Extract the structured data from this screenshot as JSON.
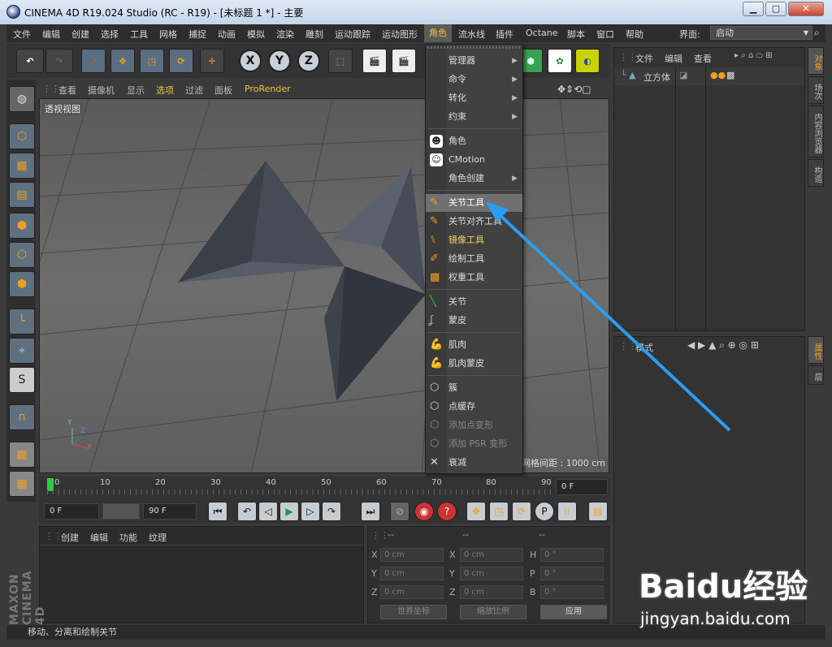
{
  "window": {
    "title": "CINEMA 4D R19.024 Studio (RC - R19) - [未标题 1 *] - 主要",
    "min": "▁",
    "max": "▢",
    "close": "✕"
  },
  "menubar": {
    "items": [
      "文件",
      "编辑",
      "创建",
      "选择",
      "工具",
      "网格",
      "捕捉",
      "动画",
      "模拟",
      "渲染",
      "雕刻",
      "运动跟踪",
      "运动图形",
      "角色",
      "流水线",
      "插件",
      "Octane",
      "脚本",
      "窗口",
      "帮助"
    ],
    "iface_label": "界面:",
    "iface_value": "启动"
  },
  "toolbar": {
    "x": "X",
    "y": "Y",
    "z": "Z"
  },
  "viewport": {
    "menu": [
      "查看",
      "摄像机",
      "显示",
      "选项",
      "过滤",
      "面板",
      "ProRender"
    ],
    "label": "透视视图",
    "grid_spacing": "网格间距 : 1000 cm",
    "axes": {
      "x": "X",
      "y": "Y",
      "z": "Z"
    }
  },
  "timeline": {
    "ticks": [
      "0",
      "10",
      "20",
      "30",
      "40",
      "50",
      "60",
      "70",
      "80",
      "90"
    ],
    "frame_field": "0 F"
  },
  "playback": {
    "start": "0 F",
    "end": "90 F"
  },
  "material_panel": {
    "menu": [
      "创建",
      "编辑",
      "功能",
      "纹理"
    ]
  },
  "coord_panel": {
    "headers": [
      "--",
      "--",
      "--"
    ],
    "rows": [
      {
        "a": "X",
        "av": "0 cm",
        "b": "X",
        "bv": "0 cm",
        "c": "H",
        "cv": "0 °"
      },
      {
        "a": "Y",
        "av": "0 cm",
        "b": "Y",
        "bv": "0 cm",
        "c": "P",
        "cv": "0 °"
      },
      {
        "a": "Z",
        "av": "0 cm",
        "b": "Z",
        "bv": "0 cm",
        "c": "B",
        "cv": "0 °"
      }
    ],
    "world": "世界坐标",
    "scale": "缩放比例",
    "apply": "应用"
  },
  "object_panel": {
    "menu": [
      "文件",
      "编辑",
      "查看"
    ],
    "object": "立方体"
  },
  "attr_panel": {
    "mode": "模式"
  },
  "side_tabs_top": [
    "对象",
    "场次",
    "内容浏览器",
    "构造"
  ],
  "side_tabs_bottom": [
    "属性",
    "层"
  ],
  "context_menu": {
    "items": [
      {
        "label": "管理器",
        "sub": true
      },
      {
        "label": "命令",
        "sub": true
      },
      {
        "label": "转化",
        "sub": true
      },
      {
        "label": "约束",
        "sub": true
      },
      {
        "label": "角色",
        "sub": false
      },
      {
        "label": "CMotion",
        "sub": false
      },
      {
        "label": "角色创建",
        "sub": true
      },
      {
        "label": "关节工具",
        "sub": false
      },
      {
        "label": "关节对齐工具",
        "sub": false
      },
      {
        "label": "镜像工具",
        "sub": false
      },
      {
        "label": "绘制工具",
        "sub": false
      },
      {
        "label": "权重工具",
        "sub": false
      },
      {
        "label": "关节",
        "sub": false
      },
      {
        "label": "蒙皮",
        "sub": false
      },
      {
        "label": "肌肉",
        "sub": false
      },
      {
        "label": "肌肉蒙皮",
        "sub": false
      },
      {
        "label": "簇",
        "sub": false
      },
      {
        "label": "点缓存",
        "sub": false
      },
      {
        "label": "添加点变形",
        "sub": false
      },
      {
        "label": "添加 PSR 变形",
        "sub": false
      },
      {
        "label": "衰减",
        "sub": false
      }
    ]
  },
  "statusbar": "移动、分离和绘制关节",
  "logo": "MAXON CINEMA 4D",
  "watermark": {
    "brand": "Baidu经验",
    "url": "jingyan.baidu.com"
  },
  "colors": {
    "accent": "#f0a020",
    "highlight": "#707070",
    "arrow": "#2a9df0"
  }
}
